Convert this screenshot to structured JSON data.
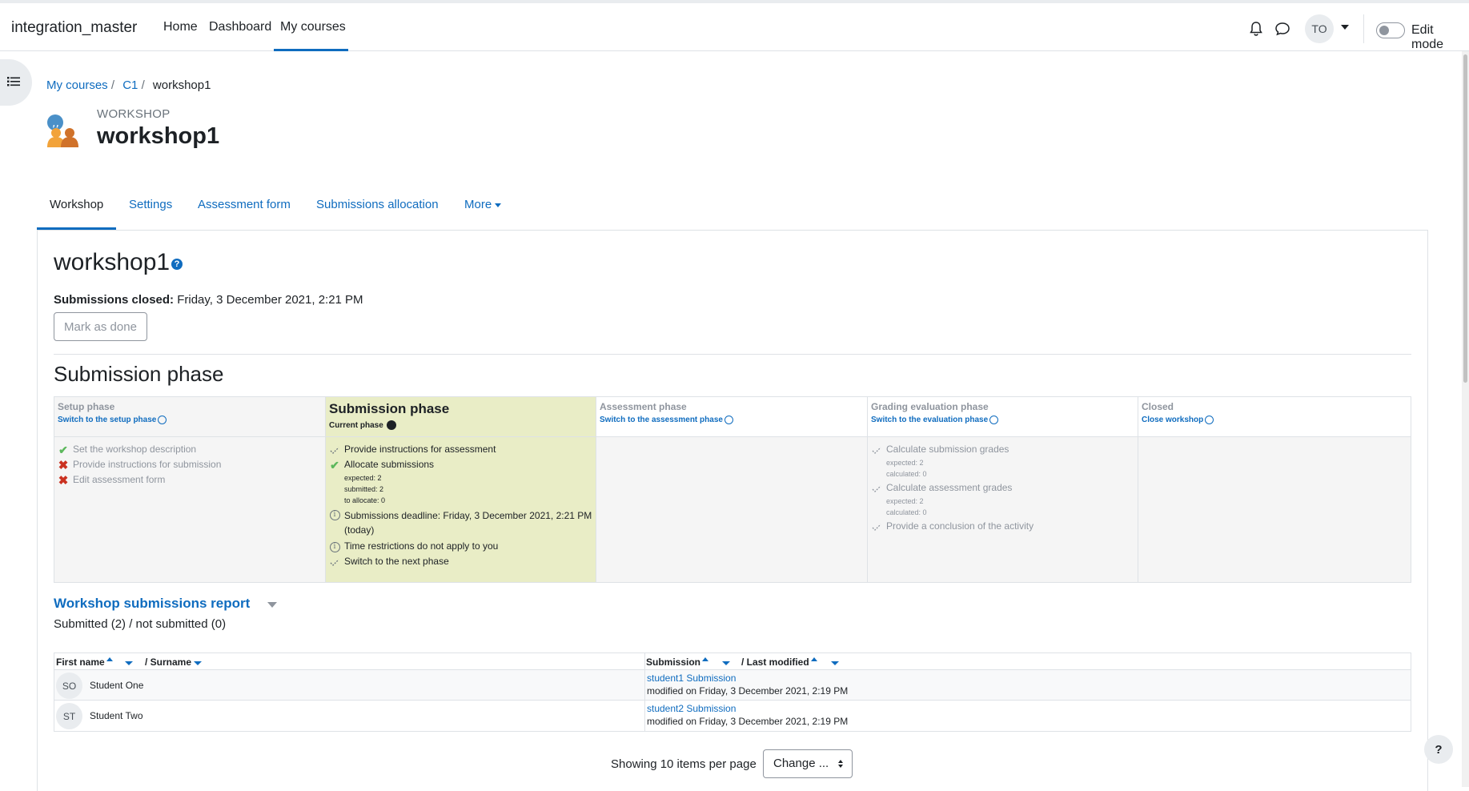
{
  "navbar": {
    "brand": "integration_master",
    "links": [
      "Home",
      "Dashboard",
      "My courses"
    ],
    "avatar_initials": "TO",
    "edit_mode_label": "Edit mode"
  },
  "breadcrumb": [
    "My courses",
    "C1",
    "workshop1"
  ],
  "activity": {
    "kind": "WORKSHOP",
    "title": "workshop1"
  },
  "tabs": [
    "Workshop",
    "Settings",
    "Assessment form",
    "Submissions allocation",
    "More"
  ],
  "main": {
    "heading": "workshop1",
    "help_icon": "?",
    "submissions_closed_label": "Submissions closed:",
    "submissions_closed_value": "Friday, 3 December 2021, 2:21 PM",
    "mark_done": "Mark as done",
    "phase_heading": "Submission phase"
  },
  "phases": [
    {
      "name": "Setup phase",
      "link": "Switch to the setup phase",
      "tasks": [
        {
          "status": "ok",
          "text": "Set the workshop description"
        },
        {
          "status": "fail",
          "text": "Provide instructions for submission"
        },
        {
          "status": "fail",
          "text": "Edit assessment form"
        }
      ]
    },
    {
      "name": "Submission phase",
      "current_label": "Current phase",
      "tasks": [
        {
          "status": "todo",
          "text": "Provide instructions for assessment"
        },
        {
          "status": "ok",
          "text": "Allocate submissions",
          "details": [
            "expected: 2",
            "submitted: 2",
            "to allocate: 0"
          ]
        },
        {
          "status": "info",
          "text": "Submissions deadline: Friday, 3 December 2021, 2:21 PM (today)"
        },
        {
          "status": "info",
          "text": "Time restrictions do not apply to you"
        },
        {
          "status": "todo",
          "text": "Switch to the next phase"
        }
      ]
    },
    {
      "name": "Assessment phase",
      "link": "Switch to the assessment phase",
      "tasks": []
    },
    {
      "name": "Grading evaluation phase",
      "link": "Switch to the evaluation phase",
      "tasks": [
        {
          "status": "todo",
          "text": "Calculate submission grades",
          "details": [
            "expected: 2",
            "calculated: 0"
          ]
        },
        {
          "status": "todo",
          "text": "Calculate assessment grades",
          "details": [
            "expected: 2",
            "calculated: 0"
          ]
        },
        {
          "status": "todo",
          "text": "Provide a conclusion of the activity"
        }
      ]
    },
    {
      "name": "Closed",
      "link": "Close workshop",
      "tasks": []
    }
  ],
  "report": {
    "title": "Workshop submissions report",
    "summary": "Submitted (2) / not submitted (0)",
    "headers": {
      "first_name": "First name",
      "surname": "/ Surname",
      "submission": "Submission",
      "last_modified": "/ Last modified"
    },
    "rows": [
      {
        "initials": "SO",
        "name": "Student One",
        "submission": "student1 Submission",
        "modified": "modified on Friday, 3 December 2021, 2:19 PM"
      },
      {
        "initials": "ST",
        "name": "Student Two",
        "submission": "student2 Submission",
        "modified": "modified on Friday, 3 December 2021, 2:19 PM"
      }
    ]
  },
  "paging": {
    "label": "Showing 10 items per page",
    "change": "Change ..."
  },
  "help_button": "?"
}
